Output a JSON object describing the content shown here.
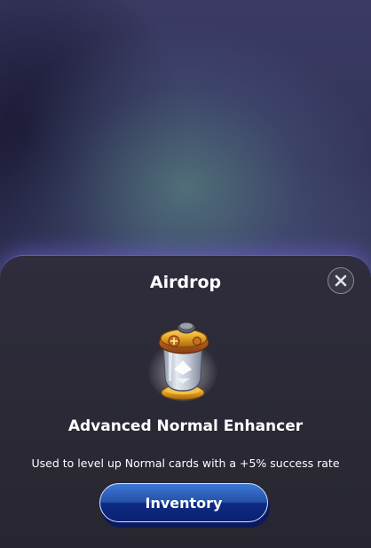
{
  "modal": {
    "title": "Airdrop",
    "item": {
      "name": "Advanced Normal Enhancer",
      "description": "Used to level up Normal cards with a +5% success rate",
      "icon": "enhancer-potion-icon"
    },
    "primary_button": "Inventory",
    "close_icon": "close-icon"
  },
  "colors": {
    "sheet": "#2a2935",
    "button": "#1f4aa3",
    "accent_glow": "#6a5ac0",
    "gold": "#e8a825"
  }
}
